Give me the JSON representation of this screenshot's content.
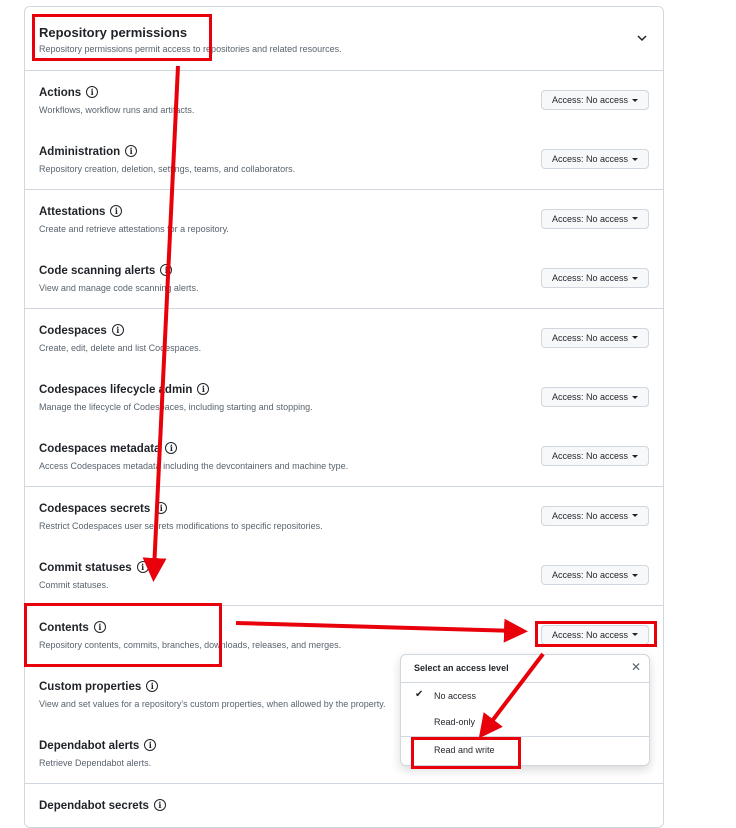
{
  "header": {
    "title": "Repository permissions",
    "subtitle": "Repository permissions permit access to repositories and related resources."
  },
  "permissions": [
    {
      "title": "Actions",
      "desc": "Workflows, workflow runs and artifacts.",
      "access": "Access: No access"
    },
    {
      "title": "Administration",
      "desc": "Repository creation, deletion, settings, teams, and collaborators.",
      "access": "Access: No access"
    },
    {
      "title": "Attestations",
      "desc": "Create and retrieve attestations for a repository.",
      "access": "Access: No access"
    },
    {
      "title": "Code scanning alerts",
      "desc": "View and manage code scanning alerts.",
      "access": "Access: No access"
    },
    {
      "title": "Codespaces",
      "desc": "Create, edit, delete and list Codespaces.",
      "access": "Access: No access"
    },
    {
      "title": "Codespaces lifecycle admin",
      "desc": "Manage the lifecycle of Codespaces, including starting and stopping.",
      "access": "Access: No access"
    },
    {
      "title": "Codespaces metadata",
      "desc": "Access Codespaces metadata including the devcontainers and machine type.",
      "access": "Access: No access"
    },
    {
      "title": "Codespaces secrets",
      "desc": "Restrict Codespaces user secrets modifications to specific repositories.",
      "access": "Access: No access"
    },
    {
      "title": "Commit statuses",
      "desc": "Commit statuses.",
      "access": "Access: No access"
    },
    {
      "title": "Contents",
      "desc": "Repository contents, commits, branches, downloads, releases, and merges.",
      "access": "Access: No access"
    },
    {
      "title": "Custom properties",
      "desc": "View and set values for a repository's custom properties, when allowed by the property.",
      "access": ""
    },
    {
      "title": "Dependabot alerts",
      "desc": "Retrieve Dependabot alerts.",
      "access": ""
    },
    {
      "title": "Dependabot secrets",
      "desc": "",
      "access": ""
    }
  ],
  "dropdown": {
    "title": "Select an access level",
    "options": [
      "No access",
      "Read-only",
      "Read and write"
    ],
    "selected": "No access"
  },
  "colors": {
    "annotation": "#e8000b",
    "border": "#d0d7de"
  }
}
